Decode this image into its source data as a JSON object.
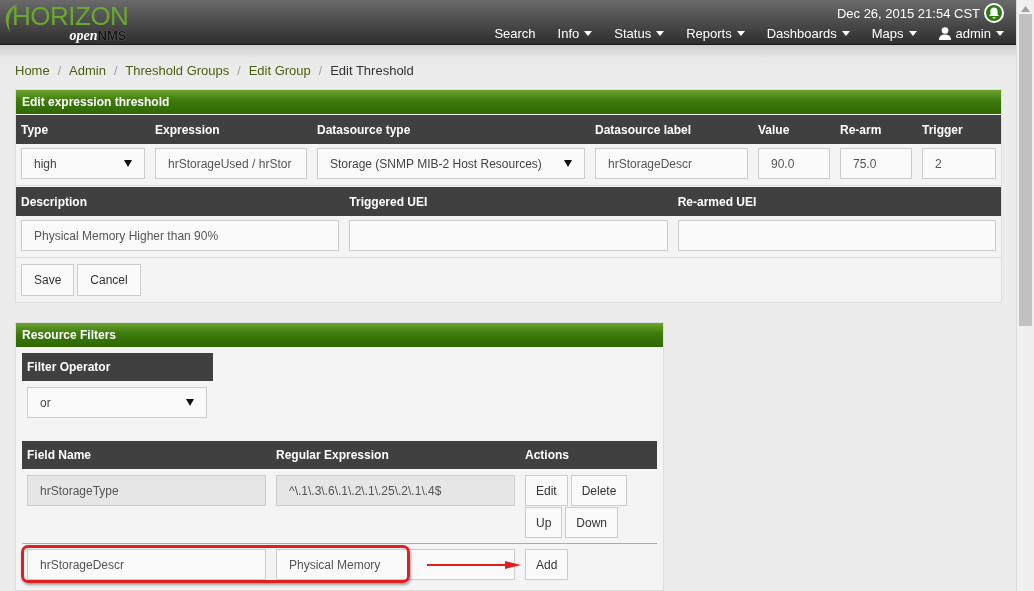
{
  "header": {
    "logo": {
      "word": "HORIZON",
      "sub_a": "open",
      "sub_b": "NMS"
    },
    "datetime": "Dec 26, 2015 21:54 CST",
    "nav": [
      {
        "label": "Search",
        "dropdown": false
      },
      {
        "label": "Info",
        "dropdown": true
      },
      {
        "label": "Status",
        "dropdown": true
      },
      {
        "label": "Reports",
        "dropdown": true
      },
      {
        "label": "Dashboards",
        "dropdown": true
      },
      {
        "label": "Maps",
        "dropdown": true
      }
    ],
    "user": {
      "label": "admin",
      "dropdown": true
    }
  },
  "breadcrumb": {
    "separator": "/",
    "items": [
      {
        "label": "Home",
        "current": false
      },
      {
        "label": "Admin",
        "current": false
      },
      {
        "label": "Threshold Groups",
        "current": false
      },
      {
        "label": "Edit Group",
        "current": false
      },
      {
        "label": "Edit Threshold",
        "current": true
      }
    ]
  },
  "threshold_panel": {
    "title": "Edit expression threshold",
    "row1_headers": [
      "Type",
      "Expression",
      "Datasource type",
      "Datasource label",
      "Value",
      "Re-arm",
      "Trigger"
    ],
    "row1_fields": [
      {
        "kind": "select",
        "value": "high"
      },
      {
        "kind": "input",
        "value": "hrStorageUsed / hrStor"
      },
      {
        "kind": "select",
        "value": "Storage (SNMP MIB-2 Host Resources)"
      },
      {
        "kind": "input",
        "value": "hrStorageDescr"
      },
      {
        "kind": "input",
        "value": "90.0"
      },
      {
        "kind": "input",
        "value": "75.0"
      },
      {
        "kind": "input",
        "value": "2"
      }
    ],
    "row2_headers": [
      "Description",
      "Triggered UEI",
      "Re-armed UEI"
    ],
    "row2_fields": [
      {
        "kind": "input",
        "value": "Physical Memory Higher than 90%"
      },
      {
        "kind": "input"
      },
      {
        "kind": "input"
      }
    ],
    "buttons": [
      "Save",
      "Cancel"
    ]
  },
  "filters_panel": {
    "title": "Resource Filters",
    "operator_heading": "Filter Operator",
    "operator": "or",
    "columns": [
      "Field Name",
      "Regular Expression",
      "Actions"
    ],
    "rows": [
      {
        "field": "hrStorageType",
        "regex": "^\\.1\\.3\\.6\\.1\\.2\\.1\\.25\\.2\\.1\\.4$",
        "disabled": true,
        "actions": [
          "Edit",
          "Delete",
          "Up",
          "Down"
        ]
      }
    ],
    "new_row": {
      "field": "hrStorageDescr",
      "regex": "Physical Memory",
      "highlighted": true,
      "action": "Add"
    }
  }
}
